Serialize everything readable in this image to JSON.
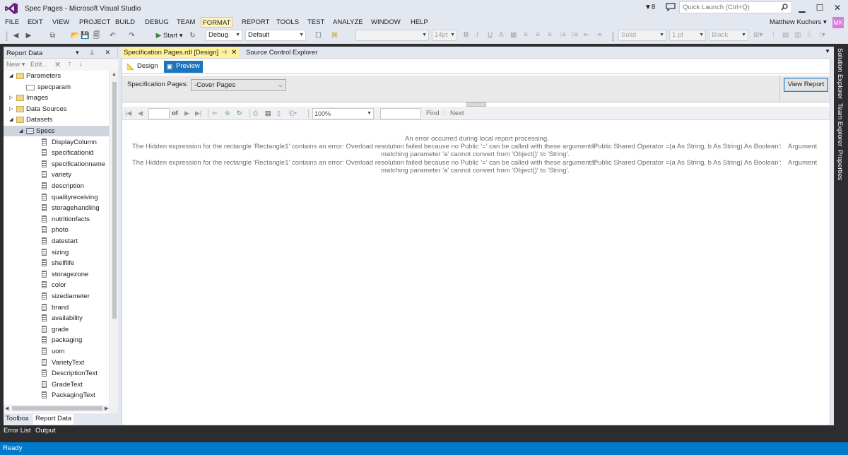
{
  "window": {
    "title": "Spec Pages - Microsoft Visual Studio",
    "notification_count": "8",
    "quick_launch_placeholder": "Quick Launch (Ctrl+Q)",
    "minimize": "▁",
    "maximize": "☐",
    "close": "✕"
  },
  "menu": {
    "items": [
      "FILE",
      "EDIT",
      "VIEW",
      "PROJECT",
      "BUILD",
      "DEBUG",
      "TEAM",
      "FORMAT",
      "REPORT",
      "TOOLS",
      "TEST",
      "ANALYZE",
      "WINDOW",
      "HELP"
    ],
    "active": "FORMAT",
    "user_name": "Matthew Kuchers",
    "user_initials": "MK"
  },
  "toolbar": {
    "start_label": "Start",
    "config": "Debug",
    "platform": "Default",
    "font_size": "14pt",
    "line_style": "Solid",
    "line_width": "1 pt",
    "line_color": "Black",
    "bold": "B",
    "italic": "I",
    "underline": "U",
    "font_color": "A"
  },
  "left_panel": {
    "title": "Report Data",
    "pin_icon": "▾ ⊥ ✕",
    "new_label": "New ▾",
    "edit_label": "Edit...",
    "tree": [
      {
        "label": "Parameters",
        "level": 0,
        "expander": "◢",
        "icon": "folder"
      },
      {
        "label": "specparam",
        "level": 1,
        "expander": "",
        "icon": "param"
      },
      {
        "label": "Images",
        "level": 0,
        "expander": "▷",
        "icon": "folder"
      },
      {
        "label": "Data Sources",
        "level": 0,
        "expander": "▷",
        "icon": "folder"
      },
      {
        "label": "Datasets",
        "level": 0,
        "expander": "◢",
        "icon": "folder"
      },
      {
        "label": "Specs",
        "level": 1,
        "expander": "◢",
        "icon": "table",
        "selected": true
      },
      {
        "label": "DisplayColumn",
        "level": 2,
        "icon": "field"
      },
      {
        "label": "specificationid",
        "level": 2,
        "icon": "field"
      },
      {
        "label": "specificationname",
        "level": 2,
        "icon": "field"
      },
      {
        "label": "variety",
        "level": 2,
        "icon": "field"
      },
      {
        "label": "description",
        "level": 2,
        "icon": "field"
      },
      {
        "label": "qualityreceiving",
        "level": 2,
        "icon": "field"
      },
      {
        "label": "storagehandling",
        "level": 2,
        "icon": "field"
      },
      {
        "label": "nutritionfacts",
        "level": 2,
        "icon": "field"
      },
      {
        "label": "photo",
        "level": 2,
        "icon": "field"
      },
      {
        "label": "datestart",
        "level": 2,
        "icon": "field"
      },
      {
        "label": "sizing",
        "level": 2,
        "icon": "field"
      },
      {
        "label": "shelflife",
        "level": 2,
        "icon": "field"
      },
      {
        "label": "storagezone",
        "level": 2,
        "icon": "field"
      },
      {
        "label": "color",
        "level": 2,
        "icon": "field"
      },
      {
        "label": "sizediameter",
        "level": 2,
        "icon": "field"
      },
      {
        "label": "brand",
        "level": 2,
        "icon": "field"
      },
      {
        "label": "availability",
        "level": 2,
        "icon": "field"
      },
      {
        "label": "grade",
        "level": 2,
        "icon": "field"
      },
      {
        "label": "packaging",
        "level": 2,
        "icon": "field"
      },
      {
        "label": "uom",
        "level": 2,
        "icon": "field"
      },
      {
        "label": "VarietyText",
        "level": 2,
        "icon": "field"
      },
      {
        "label": "DescriptionText",
        "level": 2,
        "icon": "field"
      },
      {
        "label": "GradeText",
        "level": 2,
        "icon": "field"
      },
      {
        "label": "PackagingText",
        "level": 2,
        "icon": "field"
      }
    ],
    "tabs": [
      "Toolbox",
      "Report Data"
    ],
    "active_tab": "Report Data"
  },
  "document": {
    "active_tab": "Specification Pages.rdl [Design]",
    "inactive_tab": "Source Control Explorer",
    "design_tab": "Design",
    "preview_tab": "Preview",
    "param_label": "Specification Pages:",
    "param_value": "-Cover Pages",
    "view_report_label": "View Report",
    "page_of": "of",
    "zoom": "100%",
    "find_label": "Find",
    "next_label": "Next",
    "error_title": "An error occurred during local report processing.",
    "errors": [
      {
        "line1": "The Hidden expression for the rectangle 'Rectangle1' contains an error: Overload resolution failed because no Public '=' can be called with these arguments:",
        "line1_b": "'Public Shared Operator =(a As String, b As String) As Boolean':",
        "line1_c": "Argument",
        "line2": "matching parameter 'a' cannot convert from 'Object()' to 'String'."
      },
      {
        "line1": "The Hidden expression for the rectangle 'Rectangle1' contains an error: Overload resolution failed because no Public '=' can be called with these arguments:",
        "line1_b": "'Public Shared Operator =(a As String, b As String) As Boolean':",
        "line1_c": "Argument",
        "line2": "matching parameter 'a' cannot convert from 'Object()' to 'String'."
      }
    ]
  },
  "right_panel": {
    "tabs": [
      "Solution Explorer",
      "Team Explorer",
      "Properties"
    ]
  },
  "bottom": {
    "tabs": [
      "Error List",
      "Output"
    ],
    "status": "Ready"
  },
  "colors": {
    "accent": "#007acc",
    "preview_tab": "#1c75bc",
    "active_doc_tab": "#fff29d",
    "dark_chrome": "#2d2d30"
  }
}
